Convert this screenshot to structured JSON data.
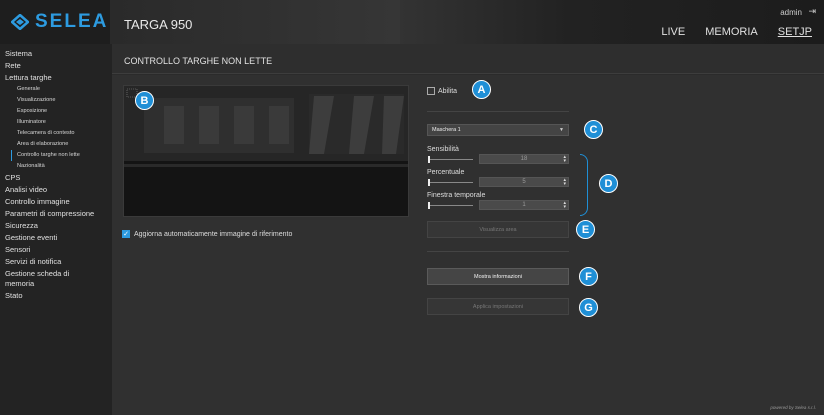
{
  "header": {
    "logo_text": "SELEA",
    "app_title": "TARGA 950",
    "user": "admin",
    "logout_icon": "logout-icon",
    "nav": [
      {
        "label": "LIVE"
      },
      {
        "label": "MEMORIA"
      },
      {
        "label": "SETJP"
      }
    ]
  },
  "sidebar": {
    "items": [
      {
        "label": "Sistema"
      },
      {
        "label": "Rete"
      },
      {
        "label": "Lettura targhe"
      }
    ],
    "sub_items": [
      {
        "label": "Generale"
      },
      {
        "label": "Visualizzazione"
      },
      {
        "label": "Esposizione"
      },
      {
        "label": "Illuminatore"
      },
      {
        "label": "Telecamera di contesto"
      },
      {
        "label": "Area di elaborazione"
      },
      {
        "label": "Controllo targhe non lette"
      },
      {
        "label": "Nazionalità"
      }
    ],
    "items_after": [
      {
        "label": "CPS"
      },
      {
        "label": "Analisi video"
      },
      {
        "label": "Controllo immagine"
      },
      {
        "label": "Parametri di compressione"
      },
      {
        "label": "Sicurezza"
      },
      {
        "label": "Gestione eventi"
      },
      {
        "label": "Sensori"
      },
      {
        "label": "Servizi di notifica"
      },
      {
        "label": "Gestione scheda di memoria"
      },
      {
        "label": "Stato"
      }
    ]
  },
  "main": {
    "page_title": "CONTROLLO TARGHE NON LETTE",
    "auto_update_label": "Aggiorna automaticamente immagine di riferimento",
    "enable_label": "Abilita",
    "mask_select": "Maschera 1",
    "sliders": [
      {
        "label": "Sensibilità",
        "value": "18"
      },
      {
        "label": "Percentuale",
        "value": "5"
      },
      {
        "label": "Finestra temporale",
        "value": "1"
      }
    ],
    "view_area_button": "Visualizza area",
    "show_info_button": "Mostra informazioni",
    "apply_button": "Applica impostazioni",
    "powered_by": "powered by Selea s.r.l."
  },
  "badges": {
    "a": "A",
    "b": "B",
    "c": "C",
    "d": "D",
    "e": "E",
    "f": "F",
    "g": "G"
  },
  "colors": {
    "accent": "#1f8fd6",
    "background": "#303030",
    "sidebar": "#232323"
  }
}
